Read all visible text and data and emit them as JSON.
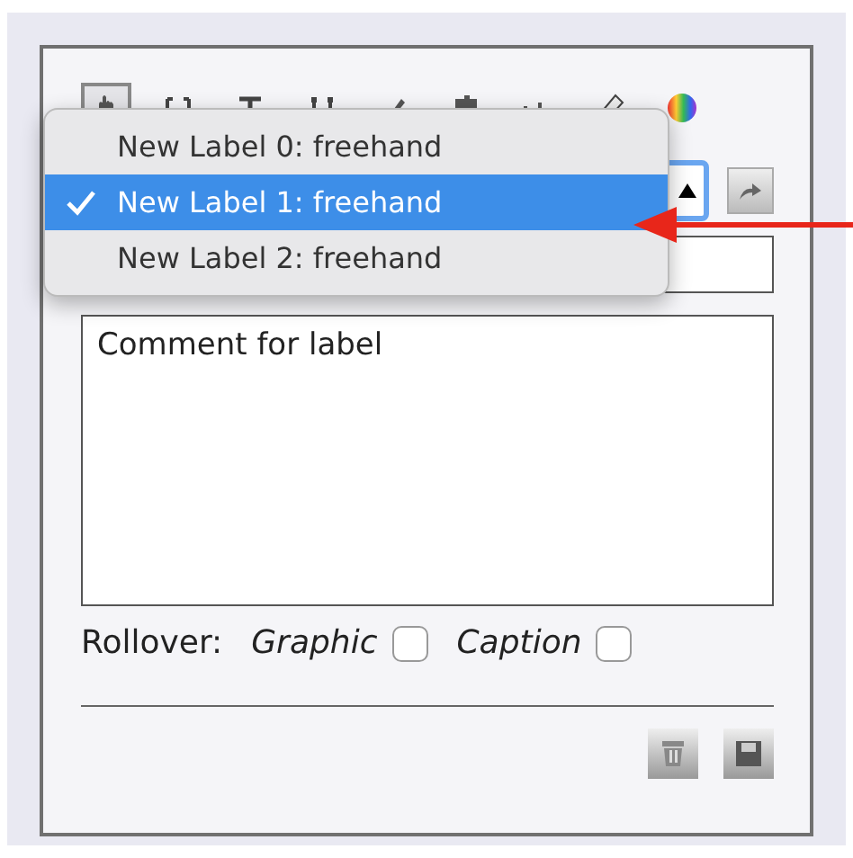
{
  "toolbar": {
    "tools": [
      {
        "kind": "hand",
        "selected": true
      },
      {
        "kind": "brackets",
        "selected": false
      },
      {
        "kind": "text",
        "selected": false
      },
      {
        "kind": "handles",
        "selected": false
      },
      {
        "kind": "pen",
        "selected": false
      },
      {
        "kind": "puzzle",
        "selected": false
      },
      {
        "kind": "dots",
        "selected": false
      },
      {
        "kind": "ruler",
        "selected": false
      },
      {
        "kind": "color",
        "selected": false
      }
    ]
  },
  "label_menu": {
    "items": [
      {
        "label": "New Label 0: freehand",
        "selected": false
      },
      {
        "label": "New Label 1: freehand",
        "selected": true
      },
      {
        "label": "New Label 2: freehand",
        "selected": false
      }
    ]
  },
  "comment": {
    "value": "Comment for label"
  },
  "rollover": {
    "label": "Rollover:",
    "options": [
      {
        "label": "Graphic",
        "checked": false
      },
      {
        "label": "Caption",
        "checked": false
      }
    ]
  }
}
